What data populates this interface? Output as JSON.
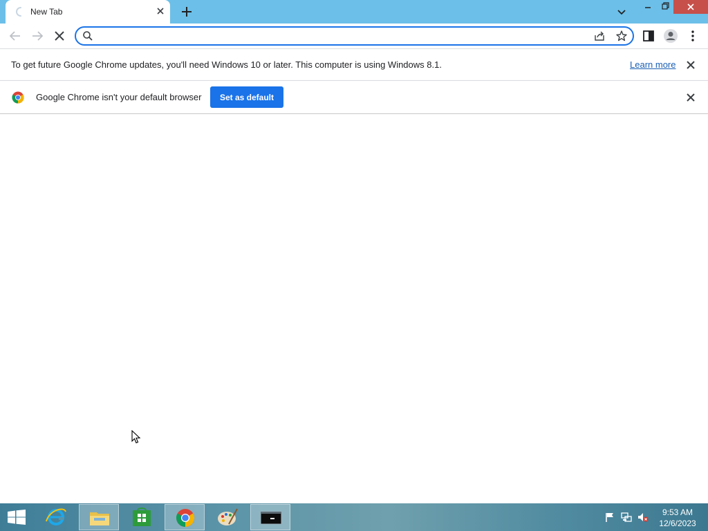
{
  "browser": {
    "tab": {
      "title": "New Tab"
    },
    "omnibox": {
      "value": "",
      "placeholder": ""
    }
  },
  "infobars": {
    "update": {
      "message": "To get future Google Chrome updates, you'll need Windows 10 or later. This computer is using Windows 8.1.",
      "link_label": "Learn more"
    },
    "default_browser": {
      "message": "Google Chrome isn't your default browser",
      "button_label": "Set as default"
    }
  },
  "taskbar": {
    "apps": [
      "internet-explorer",
      "file-explorer",
      "store",
      "chrome",
      "paint",
      "command-prompt"
    ],
    "active_app": "chrome",
    "clock": {
      "time": "9:53 AM",
      "date": "12/6/2023"
    }
  },
  "colors": {
    "accent": "#1a73e8",
    "tabstrip": "#6cbfe8",
    "window_close": "#c7504b",
    "link": "#1a5fb4"
  }
}
